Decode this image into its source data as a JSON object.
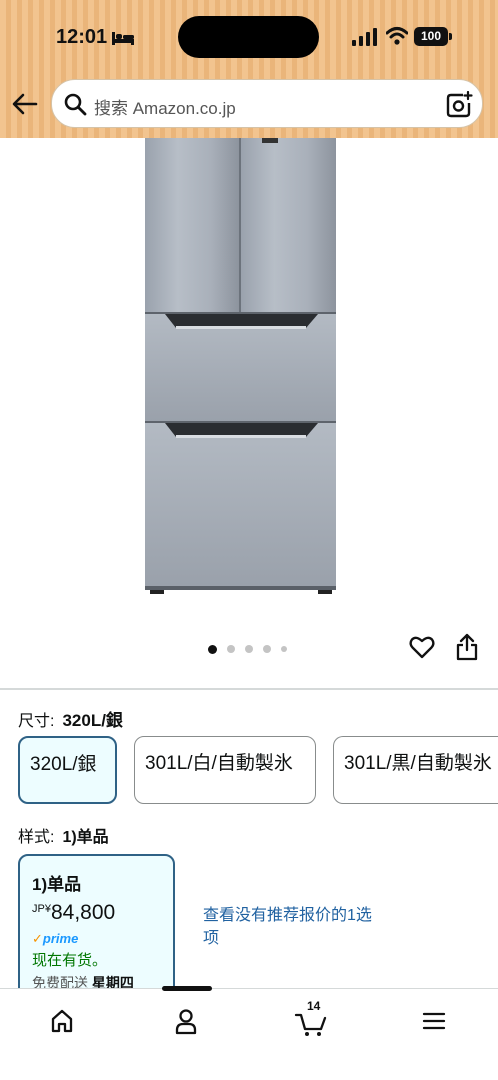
{
  "status_bar": {
    "time": "12:01",
    "battery": "100"
  },
  "search": {
    "placeholder": "搜索 Amazon.co.jp"
  },
  "gallery": {
    "image_count": 5,
    "active_index": 0
  },
  "variations": {
    "size_label": "尺寸:",
    "size_selected": "320L/銀",
    "size_options": [
      "320L/銀",
      "301L/白/自動製氷",
      "301L/黒/自動製氷"
    ],
    "style_label": "样式:",
    "style_selected": "1)单品"
  },
  "style_card": {
    "name": "1)单品",
    "currency": "JP¥",
    "price": "84,800",
    "prime": "prime",
    "availability": "现在有货。",
    "delivery_prefix": "免费配送",
    "delivery_day": "星期四"
  },
  "other_offers_link": "查看没有推荐报价的1选项",
  "bottom_nav": {
    "cart_count": "14"
  },
  "colors": {
    "header_bg": "#f2c48f",
    "selected_border": "#2f6286",
    "link": "#2162a1",
    "in_stock": "#007600"
  }
}
